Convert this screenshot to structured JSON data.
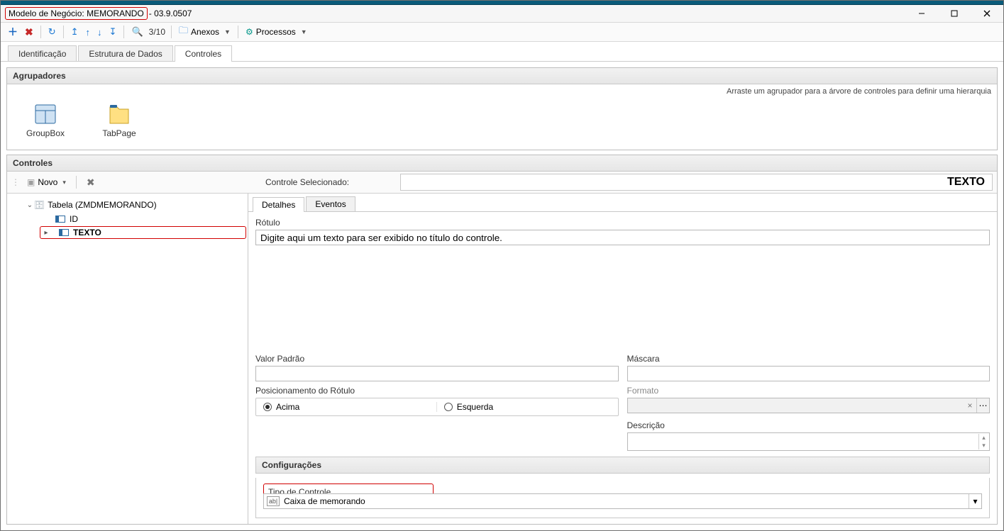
{
  "title_hl": "Modelo de Negócio: MEMORANDO",
  "title_suffix": " - 03.9.0507",
  "toolbar": {
    "rec_pos": "3/10",
    "anexos": "Anexos",
    "processos": "Processos"
  },
  "tabs": {
    "identificacao": "Identificação",
    "estrutura": "Estrutura de Dados",
    "controles": "Controles"
  },
  "agrupadores": {
    "title": "Agrupadores",
    "hint": "Arraste um agrupador para a árvore de controles para definir uma hierarquia",
    "groupbox": "GroupBox",
    "tabpage": "TabPage"
  },
  "controles": {
    "title": "Controles",
    "novo": "Novo",
    "sel_label": "Controle Selecionado:",
    "sel_value": "TEXTO"
  },
  "tree": {
    "tabela": "Tabela (ZMDMEMORANDO)",
    "id": "ID",
    "texto": "TEXTO"
  },
  "subtabs": {
    "detalhes": "Detalhes",
    "eventos": "Eventos"
  },
  "detalhes": {
    "rotulo_lbl": "Rótulo",
    "rotulo_val": "Digite aqui um texto para ser exibido no título do controle.",
    "valor_padrao_lbl": "Valor Padrão",
    "valor_padrao_val": "",
    "mascara_lbl": "Máscara",
    "mascara_val": "",
    "pos_rotulo_lbl": "Posicionamento do Rótulo",
    "pos_acima": "Acima",
    "pos_esquerda": "Esquerda",
    "formato_lbl": "Formato",
    "formato_val": "",
    "descricao_lbl": "Descrição",
    "descricao_val": ""
  },
  "config": {
    "title": "Configurações",
    "tipo_lbl": "Tipo de Controle",
    "tipo_icon": "ab|",
    "tipo_val": "Caixa de memorando"
  }
}
